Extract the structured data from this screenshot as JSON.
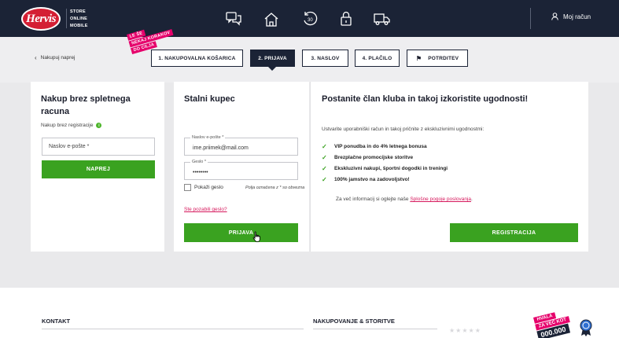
{
  "header": {
    "logo": "Hervis",
    "logo_sub": [
      "STORE",
      "ONLINE",
      "MOBILE"
    ],
    "icons": [
      "chat-icon",
      "store-icon",
      "return-icon",
      "lock-icon",
      "truck-icon"
    ],
    "account_label": "Moj račun"
  },
  "steps": {
    "back_label": "Nakupuj naprej",
    "promo": [
      "LE ŠE",
      "NEKAJ KORAKOV",
      "DO CILJA"
    ],
    "items": [
      {
        "label": "1. NAKUPOVALNA KOŠARICA",
        "active": false
      },
      {
        "label": "2. PRIJAVA",
        "active": true
      },
      {
        "label": "3. NASLOV",
        "active": false
      },
      {
        "label": "4. PLAČILO",
        "active": false
      },
      {
        "label": "POTRDITEV",
        "active": false
      }
    ]
  },
  "guest": {
    "title": "Nakup brez spletnega racuna",
    "subtitle": "Nakup brez registracije",
    "email_placeholder": "Naslov e-pošte *",
    "button": "NAPREJ"
  },
  "login": {
    "title": "Stalni kupec",
    "email_label": "Naslov e-pošte *",
    "email_value": "ime.priimek@mail.com",
    "password_label": "Geslo *",
    "password_value": "••••••••",
    "show_password": "Pokaži geslo",
    "required_note": "Polja označena z * so obvezna",
    "forgot": "Ste pozabili geslo?",
    "button": "PRIJAVA"
  },
  "club": {
    "title": "Postanite član kluba in takoj izkoristite ugodnosti!",
    "lead": "Ustvarite uporabniški račun in takoj pričnite z ekskluzivnimi ugodnostmi:",
    "benefits": [
      "VIP ponudba in do 4% letnega bonusa",
      "Brezplačne promocijske storitve",
      "Ekskluzivni nakupi, športni dogodki in treningi",
      "100% jamstvo na zadovoljstvo!"
    ],
    "more_prefix": "Za več informacij si oglejte naše",
    "more_link": "Splošne pogoje poslovanja",
    "more_suffix": ".",
    "button": "REGISTRACIJA"
  },
  "footer": {
    "col1": "KONTAKT",
    "col2": "NAKUPOVANJE & STORITVE",
    "badge": [
      "HVALA",
      "ZA VEČ KOT",
      "000.000"
    ]
  },
  "colors": {
    "navy": "#1b2336",
    "green": "#3aa220",
    "pink": "#e6006b",
    "link": "#d6185c"
  }
}
